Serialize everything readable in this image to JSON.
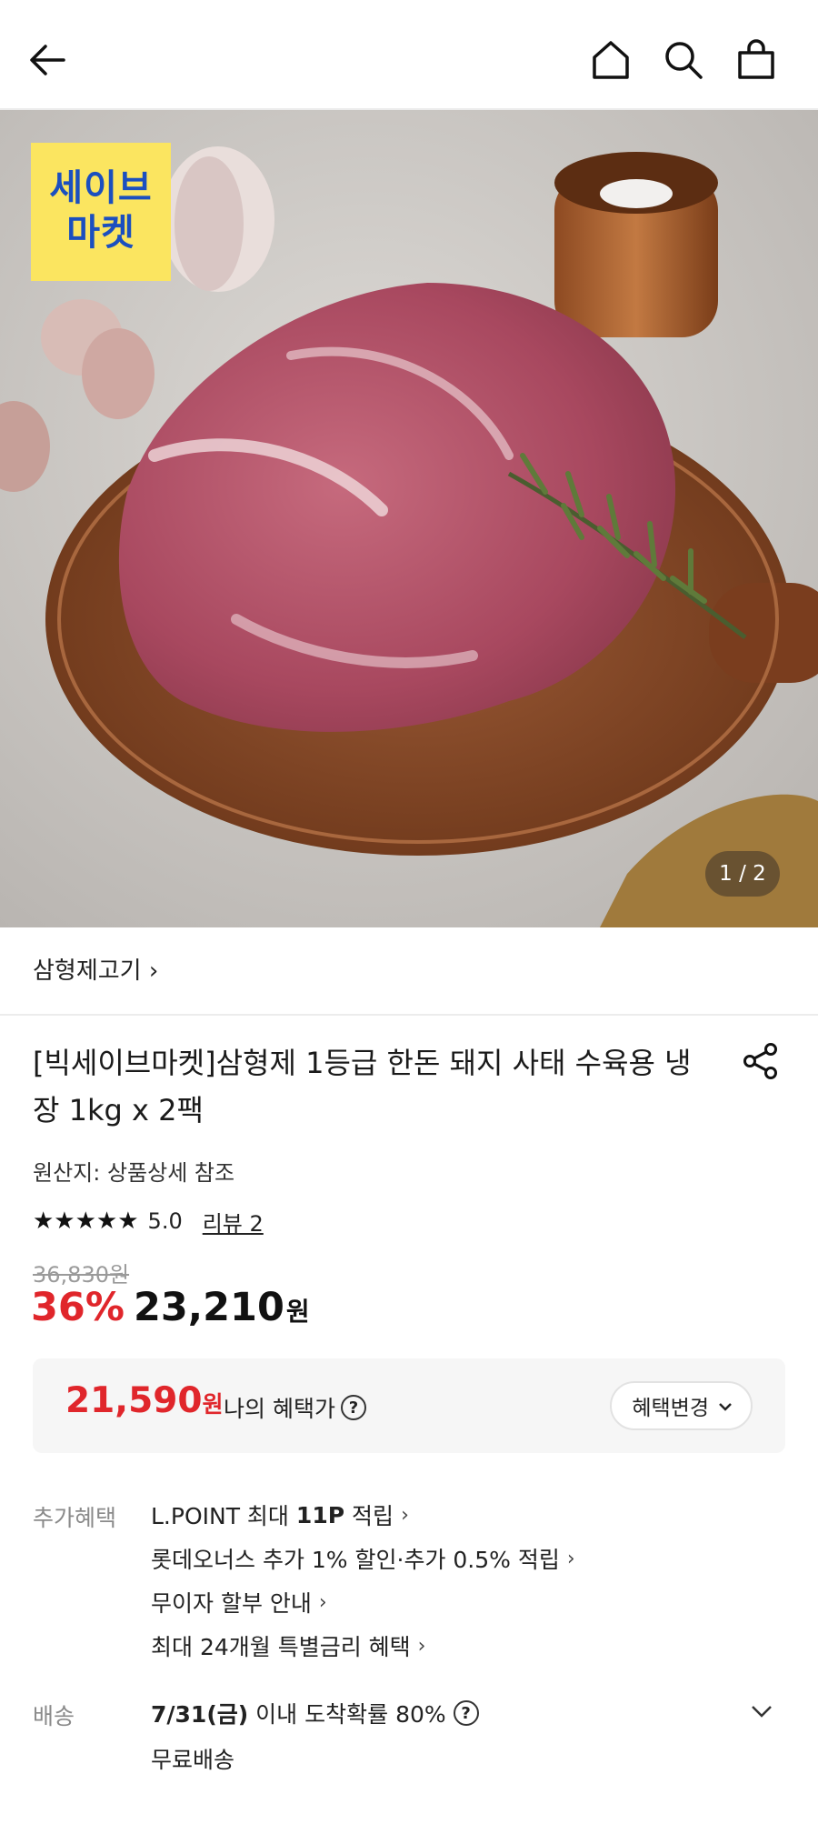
{
  "header": {
    "back": "back-arrow-icon",
    "home": "home-icon",
    "search": "search-icon",
    "cart": "shopping-bag-icon"
  },
  "hero": {
    "badge_line1": "세이브",
    "badge_line2": "마켓",
    "pager": "1 / 2"
  },
  "category": {
    "label": "삼형제고기",
    "chevron": "›"
  },
  "product": {
    "title": "[빅세이브마켓]삼형제 1등급 한돈 돼지 사태 수육용 냉장 1kg x 2팩",
    "origin": "원산지: 상품상세 참조",
    "stars": "★★★★★",
    "rating": "5.0",
    "review": "리뷰 2",
    "original_price": "36,830원",
    "discount": "36%",
    "price": "23,210",
    "price_unit": "원"
  },
  "benefit": {
    "price": "21,590",
    "unit": "원",
    "label": "나의 혜택가",
    "help": "?",
    "change_button": "혜택변경"
  },
  "extra_benefits": {
    "label": "추가혜택",
    "lpoint_prefix": "L.POINT 최대",
    "lpoint_bold": "11P",
    "lpoint_suffix": "적립",
    "lotte_members": "롯데오너스 추가 1% 할인·추가 0.5% 적립",
    "installment": "무이자 할부 안내",
    "special_rate": "최대 24개월 특별금리 혜택"
  },
  "delivery": {
    "label": "배송",
    "date": "7/31(금)",
    "desc": "이내 도착확률 80%",
    "help": "?",
    "free": "무료배송"
  },
  "colors": {
    "accent_red": "#e0262b",
    "badge_yellow": "#fbe560",
    "badge_blue": "#1b4fbf"
  }
}
